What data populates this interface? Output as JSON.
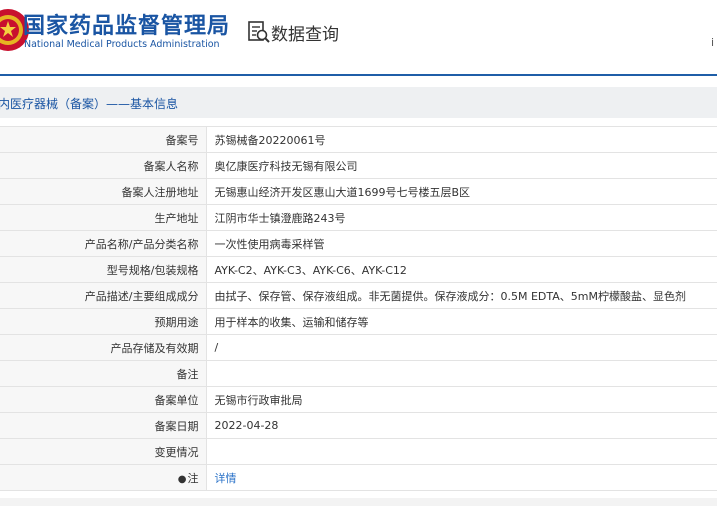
{
  "header": {
    "brand_cn": "国家药品监督管理局",
    "brand_en": "National Medical Products Administration",
    "section_link": "数据查询",
    "edge_text": "i",
    "accent_color": "#1a55a3"
  },
  "section": {
    "title": "内医疗器械（备案）——基本信息"
  },
  "rows": [
    {
      "label": "备案号",
      "value": "苏锡械备20220061号"
    },
    {
      "label": "备案人名称",
      "value": "奥亿康医疗科技无锡有限公司"
    },
    {
      "label": "备案人注册地址",
      "value": "无锡惠山经济开发区惠山大道1699号七号楼五层B区"
    },
    {
      "label": "生产地址",
      "value": "江阴市华士镇澄鹿路243号"
    },
    {
      "label": "产品名称/产品分类名称",
      "value": "一次性使用病毒采样管"
    },
    {
      "label": "型号规格/包装规格",
      "value": "AYK-C2、AYK-C3、AYK-C6、AYK-C12"
    },
    {
      "label": "产品描述/主要组成成分",
      "value": "由拭子、保存管、保存液组成。非无菌提供。保存液成分：0.5M EDTA、5mM柠檬酸盐、显色剂"
    },
    {
      "label": "预期用途",
      "value": "用于样本的收集、运输和储存等"
    },
    {
      "label": "产品存储及有效期",
      "value": "/"
    },
    {
      "label": "备注",
      "value": ""
    },
    {
      "label": "备案单位",
      "value": "无锡市行政审批局"
    },
    {
      "label": "备案日期",
      "value": "2022-04-28"
    },
    {
      "label": "变更情况",
      "value": ""
    },
    {
      "label": "注",
      "value": "详情",
      "icon": "location-pin-icon",
      "link": true
    }
  ]
}
